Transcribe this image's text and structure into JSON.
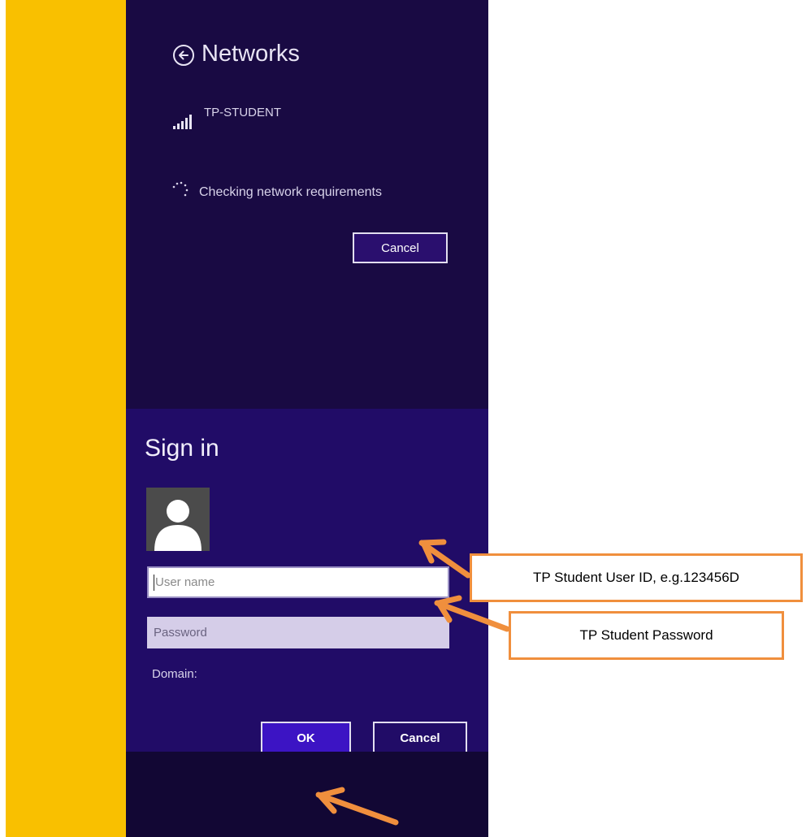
{
  "networks": {
    "title": "Networks",
    "back_icon": "back-arrow-circle-icon",
    "network_name": "TP-STUDENT",
    "signal_icon": "wifi-signal-icon",
    "status_text": "Checking network requirements",
    "cancel_label": "Cancel"
  },
  "signin": {
    "title": "Sign in",
    "avatar_icon": "user-avatar-icon",
    "username_placeholder": "User name",
    "password_placeholder": "Password",
    "domain_label": "Domain:",
    "ok_label": "OK",
    "cancel_label": "Cancel"
  },
  "annotations": {
    "userid_callout": "TP Student User ID, e.g.123456D",
    "password_callout": "TP Student Password",
    "arrow_color": "#f08f3d"
  },
  "colors": {
    "yellow_strip": "#f9c000",
    "networks_bg": "#190a43",
    "signin_bg": "#210c67",
    "ok_button_bg": "#3c14c4"
  }
}
